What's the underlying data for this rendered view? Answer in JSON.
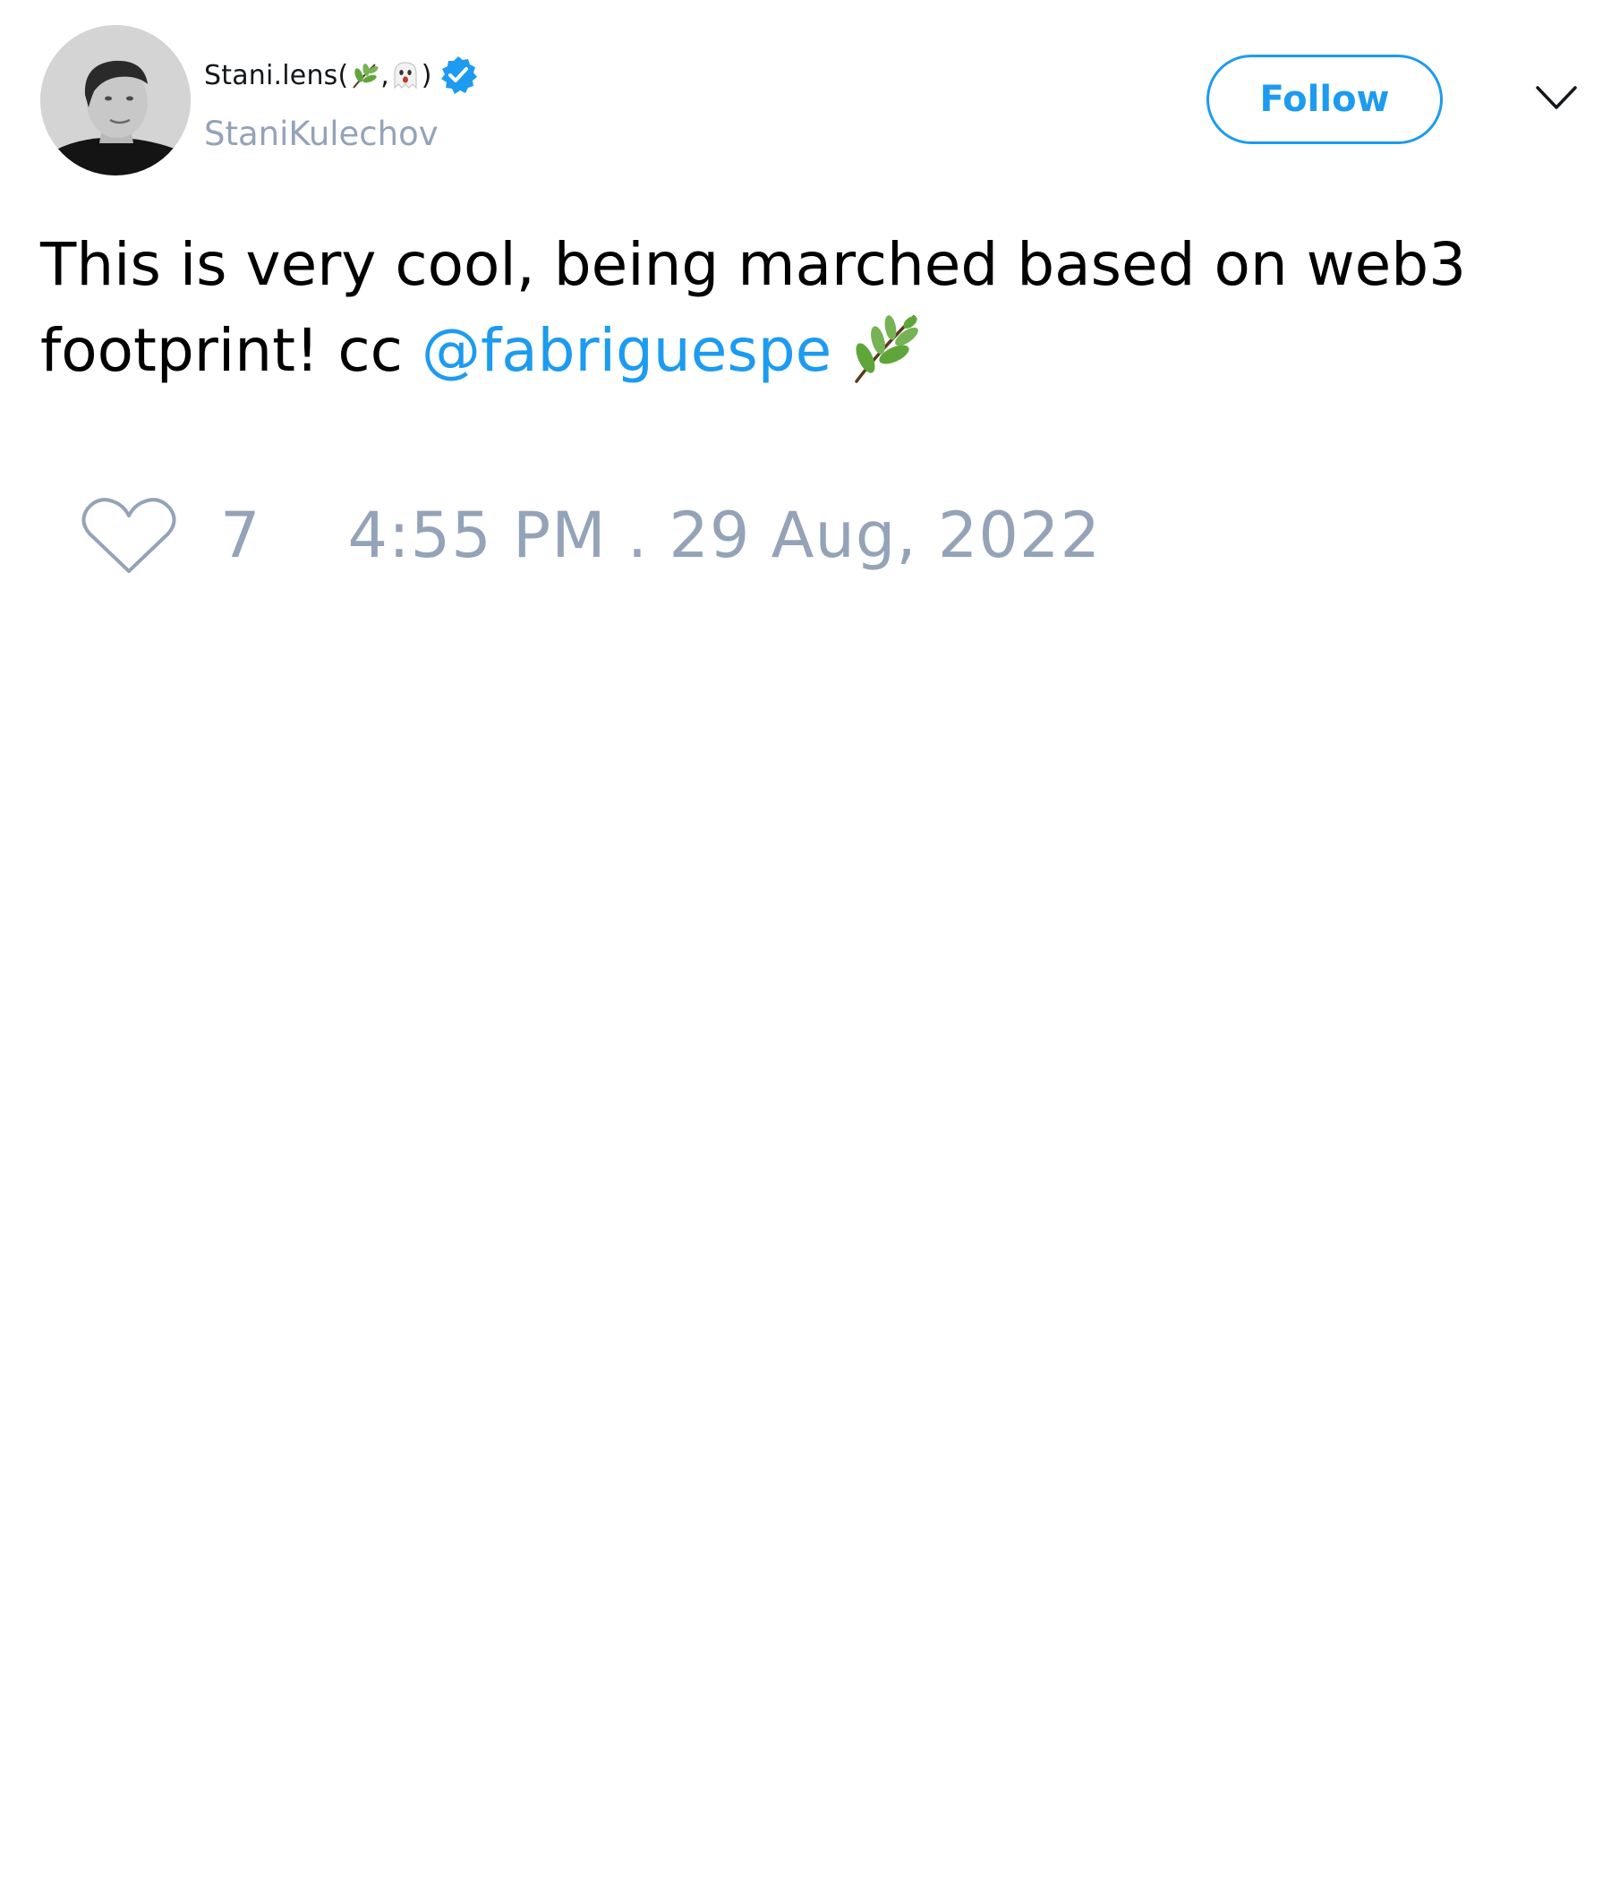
{
  "tweet": {
    "author": {
      "display_name": "Stani.lens",
      "name_paren_open": " (",
      "name_separator": ",",
      "name_paren_close": ")",
      "name_emojis": [
        "herb-emoji",
        "ghost-emoji"
      ],
      "username": "StaniKulechov",
      "verified": true
    },
    "follow_label": "Follow",
    "text_before_mention": "This is very cool, being marched based on web3 footprint! cc ",
    "mention": "@fabriguespe",
    "trailing_emoji": "herb-emoji",
    "like_count": "7",
    "timestamp": "4:55 PM . 29 Aug, 2022"
  },
  "colors": {
    "accent": "#1d9bf0",
    "muted": "#94a3b8",
    "text": "#000000"
  }
}
